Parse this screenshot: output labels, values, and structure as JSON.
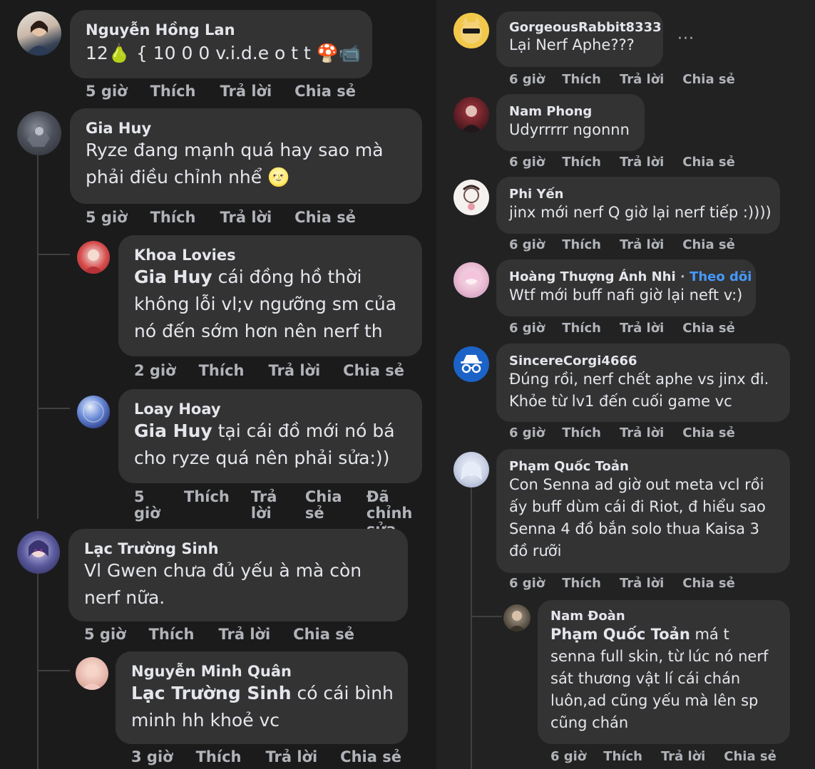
{
  "actions": {
    "like": "Thích",
    "reply": "Trả lời",
    "share": "Chia sẻ",
    "edited": "Đã chỉnh sửa"
  },
  "left": [
    {
      "name": "Nguyễn Hồng Lan",
      "text": "12🍐 { 10 0 0 v.i.d.e o t t 🍄📹",
      "time": "5 giờ"
    },
    {
      "name": "Gia Huy",
      "text": "Ryze đang mạnh quá hay sao mà phải điều chỉnh nhể 🌝",
      "time": "5 giờ"
    },
    {
      "name": "Khoa Lovies",
      "mention": "Gia Huy",
      "text": " cái đồng hồ thời không lỗi vl;v ngưỡng sm của nó đến sớm hơn nên nerf th",
      "time": "2 giờ"
    },
    {
      "name": "Loay Hoay",
      "mention": "Gia Huy",
      "text": " tại cái đồ mới nó bá cho ryze quá nên phải sửa:))",
      "time": "5 giờ"
    },
    {
      "name": "Lạc Trường Sinh",
      "text": "Vl Gwen chưa đủ yếu à mà còn nerf nữa.",
      "time": "5 giờ"
    },
    {
      "name": "Nguyễn Minh Quân",
      "mention": "Lạc Trường Sinh",
      "text": " có cái bình minh hh khoẻ vc",
      "time": "3 giờ"
    }
  ],
  "right": [
    {
      "name": "GorgeousRabbit8333",
      "text": "Lại Nerf Aphe???",
      "time": "6 giờ"
    },
    {
      "name": "Nam Phong",
      "text": "Udyrrrrr ngonnn",
      "time": "6 giờ"
    },
    {
      "name": "Phi Yến",
      "text": "jinx mới nerf Q giờ lại nerf tiếp :))))",
      "time": "6 giờ"
    },
    {
      "name": "Hoàng Thượng Ánh Nhi",
      "follow": "Theo dõi",
      "text": "Wtf mới buff nafi giờ lại neft v:)",
      "time": "6 giờ"
    },
    {
      "name": "SincereCorgi4666",
      "text": "Đúng rồi, nerf chết aphe vs jinx đi. Khỏe từ lv1 đến cuối game vc",
      "time": "6 giờ"
    },
    {
      "name": "Phạm Quốc Toản",
      "text": "Con Senna ad giờ out meta vcl rồi ấy buff dùm cái đi Riot, đ hiểu sao Senna 4 đồ bắn solo thua Kaisa 3 đồ rưỡi",
      "time": "6 giờ"
    },
    {
      "name": "Nam Đoàn",
      "mention": "Phạm Quốc Toản",
      "text": " má t senna full skin, từ lúc nó nerf sát thương vật lí cái chán luôn,ad cũng yếu mà lên sp cũng chán",
      "time": "6 giờ"
    }
  ],
  "colors": {
    "background": "#1c1c1d",
    "bubble": "#333334",
    "action_text": "#b0b3b8",
    "link": "#4599ff"
  },
  "icons": {
    "more": "more-options-icon"
  }
}
